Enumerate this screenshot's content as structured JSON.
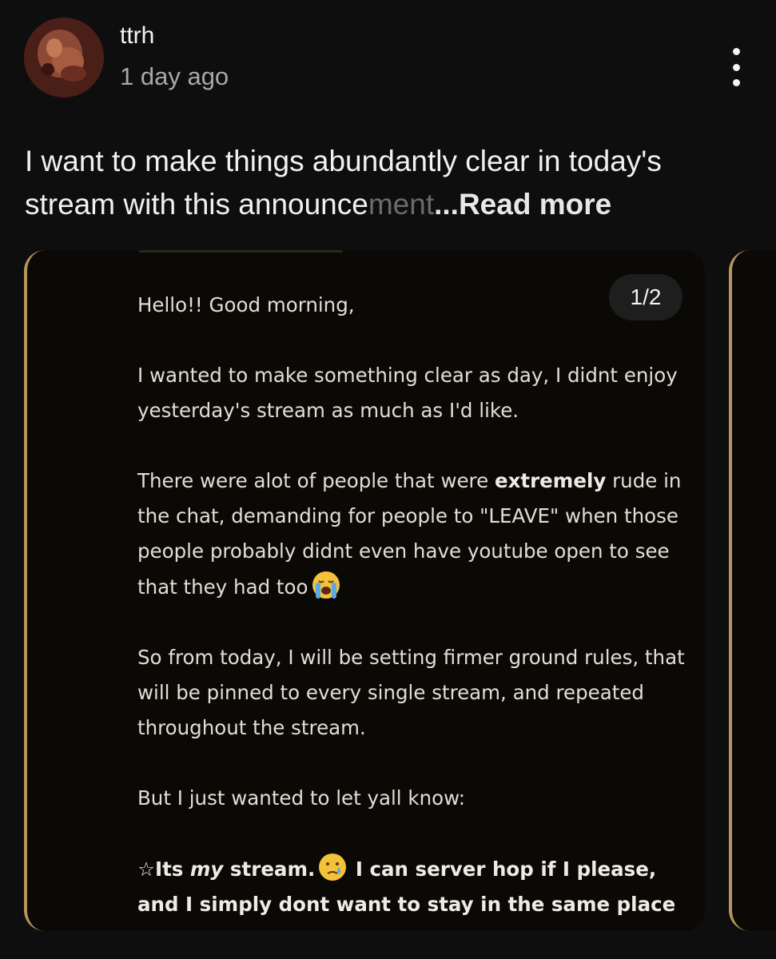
{
  "post": {
    "author": "ttrh",
    "time": "1 day ago",
    "text_main": "I want to make things abundantly clear in today's stream with this announce",
    "text_fade": "ment",
    "read_more": "...Read more"
  },
  "card": {
    "page_indicator": "1/2",
    "p1": "Hello!! Good morning,",
    "p2": "I wanted to make something clear as day, I didnt enjoy yesterday's stream as much as I'd like.",
    "p3_a": "There were alot of people that were ",
    "p3_bold": "extremely",
    "p3_b": " rude in the chat, demanding for people to \"LEAVE\" when those people probably didnt even have youtube open to see that they had too",
    "p4": "So from today, I will be setting firmer ground rules, that will be pinned to every single stream, and repeated throughout the stream.",
    "p5": "But I just wanted to let yall know:",
    "p6_a": "☆Its ",
    "p6_em": "my",
    "p6_b": " stream.",
    "p6_c": " I can server hop if I please, and I simply dont want to stay in the same place"
  },
  "icons": {
    "menu": "kebab-menu-icon",
    "emoji_1": "loudly-crying-face",
    "emoji_2": "sad-tear-face"
  },
  "colors": {
    "background": "#0e0e0e",
    "card_accent": "#b8955f",
    "muted_text": "#a8a8a8"
  }
}
